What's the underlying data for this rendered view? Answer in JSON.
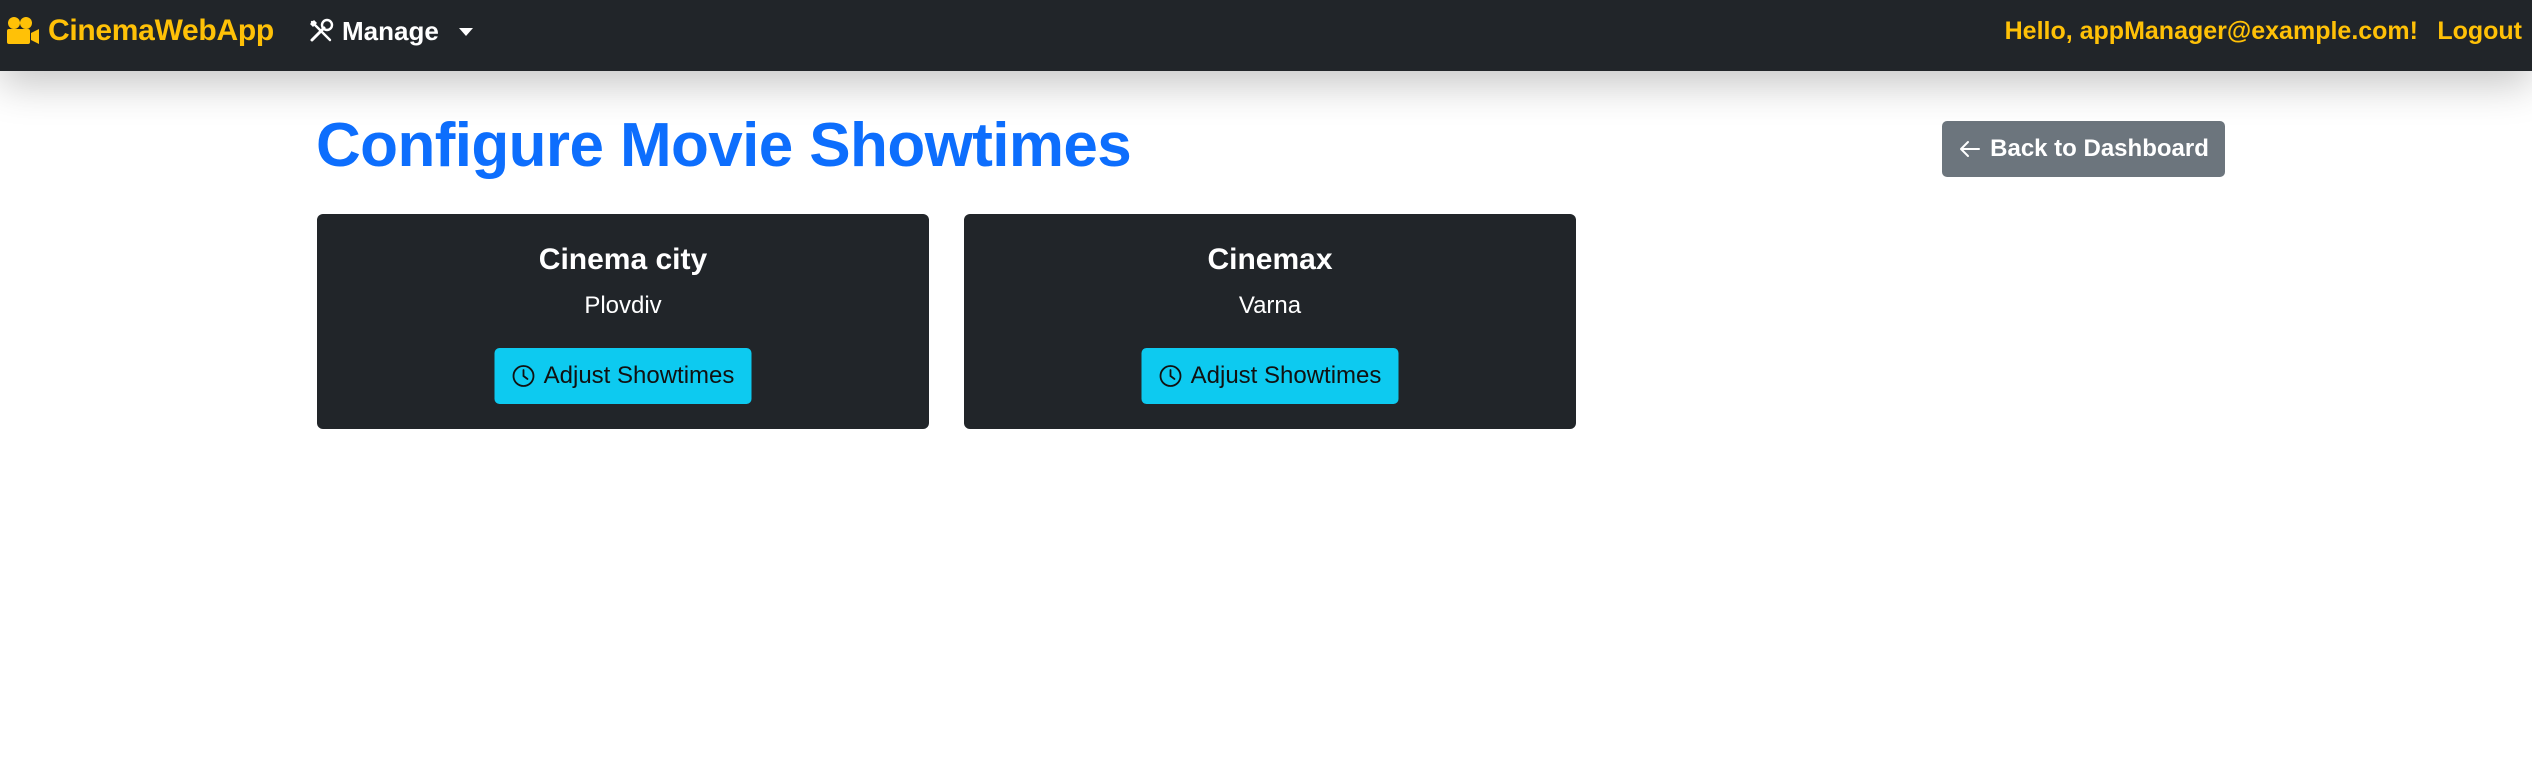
{
  "navbar": {
    "brand": "CinemaWebApp",
    "brand_icon": "camera-reels-icon",
    "manage_label": "Manage",
    "manage_icon": "tools-icon",
    "greeting": "Hello, appManager@example.com!",
    "logout_label": "Logout",
    "accent_color": "#ffc107",
    "background_color": "#212529"
  },
  "page": {
    "title": "Configure Movie Showtimes",
    "title_color": "#0d6efd",
    "back_button_label": "Back to Dashboard",
    "back_button_icon": "arrow-left-icon"
  },
  "cinemas": [
    {
      "name": "Cinema city",
      "city": "Plovdiv",
      "button_label": "Adjust Showtimes",
      "button_icon": "clock-icon"
    },
    {
      "name": "Cinemax",
      "city": "Varna",
      "button_label": "Adjust Showtimes",
      "button_icon": "clock-icon"
    }
  ]
}
